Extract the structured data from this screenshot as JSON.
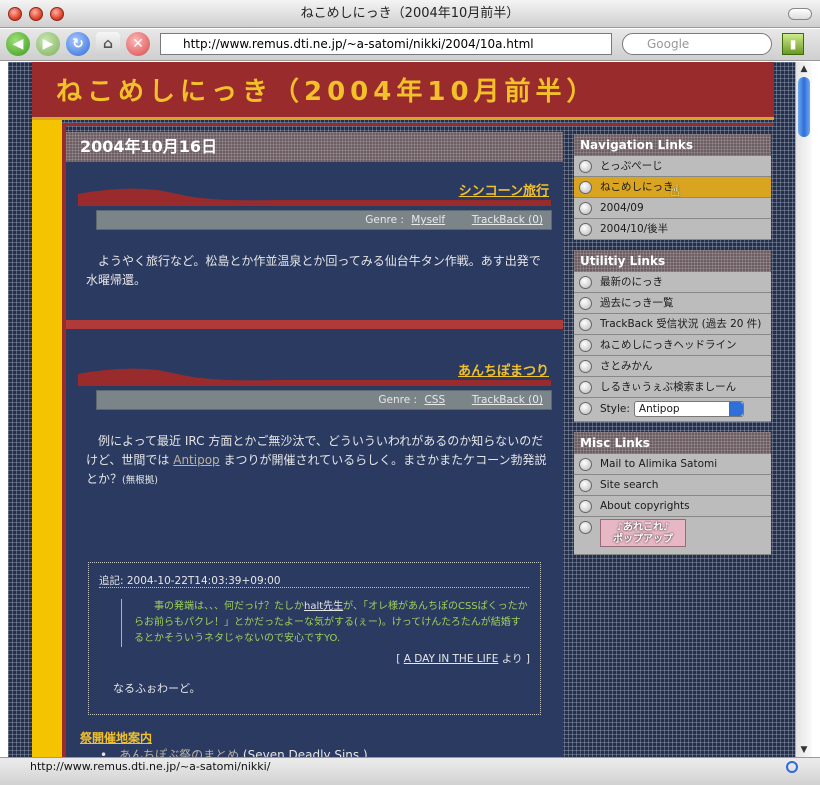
{
  "window": {
    "title": "ねこめしにっき（2004年10月前半）"
  },
  "toolbar": {
    "url": "http://www.remus.dti.ne.jp/~a-satomi/nikki/2004/10a.html",
    "search_placeholder": "Google"
  },
  "status": {
    "text": "http://www.remus.dti.ne.jp/~a-satomi/nikki/"
  },
  "site": {
    "title": "ねこめしにっき（2004年10月前半）"
  },
  "main": {
    "date": "2004年10月16日",
    "entries": [
      {
        "title": "シンコーン旅行",
        "genre_label": "Genre :",
        "genre": "Myself",
        "trackback": "TrackBack (0)",
        "body": "ようやく旅行など。松島とか作並温泉とか回ってみる仙台牛タン作戦。あす出発で水曜帰還。"
      },
      {
        "title": "あんちぽまつり",
        "genre_label": "Genre :",
        "genre": "CSS",
        "trackback": "TrackBack (0)",
        "body_before": "例によって最近 IRC 方面とかご無沙汰で、どういういわれがあるのか知らないのだけど、世間では",
        "body_link": "Antipop",
        "body_after": "まつりが開催されているらしく。まさかまたケコーン勃発説とか？",
        "body_note": "(無根拠)",
        "comment": {
          "head": "追記: 2004-10-22T14:03:39+09:00",
          "quote_before": "事の発端は、、、何だっけ？たしか",
          "quote_link": "halt先生",
          "quote_after": "が、「オレ様があんちぽのCSSぱくったからお前らもパクレ！」とかだったよーな気がする(ぇー)。けってけんたろたんが結婚するとかそういうネタじゃないので安心ですYO.",
          "source_open": "[",
          "source_link": "A DAY IN THE LIFE",
          "source_close": "より ]",
          "reply": "なるふぉわーど。"
        },
        "sub_heading": "祭開催地案内",
        "sub_item_link": "あんちぽぶ祭のまとめ",
        "sub_item_paren_open": "(",
        "sub_item_link2": "Seven Deadly Sins.",
        "sub_item_paren_close": ")"
      }
    ]
  },
  "sidebar": {
    "nav_title": "Navigation Links",
    "nav_items": [
      "とっぷぺーじ",
      "ねこめしにっき",
      "2004/09",
      "2004/10/後半"
    ],
    "utility_title": "Utilitiy Links",
    "utility_items": [
      "最新のにっき",
      "過去にっき一覧",
      "TrackBack 受信状況 (過去 20 件)",
      "ねこめしにっきヘッドライン",
      "さとみかん",
      "しるきぃうぇぶ検索ましーん"
    ],
    "style_label": "Style:",
    "style_value": "Antipop",
    "misc_title": "Misc Links",
    "misc_items": [
      "Mail to Alimika Satomi",
      "Site search",
      "About copyrights"
    ],
    "popup_label_1": "♪あれこれ♪",
    "popup_label_2": "ポップアップ"
  }
}
